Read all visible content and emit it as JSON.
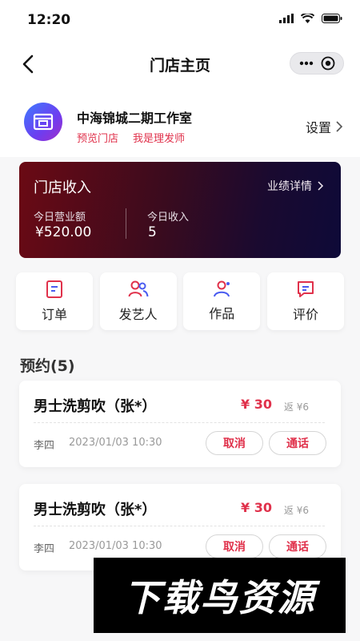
{
  "status_bar": {
    "time": "12:20"
  },
  "nav": {
    "title": "门店主页"
  },
  "store": {
    "name": "中海锦城二期工作室",
    "links": [
      "预览门店",
      "我是理发师"
    ],
    "settings_label": "设置"
  },
  "revenue": {
    "title": "门店收入",
    "detail_label": "业绩详情",
    "stats": [
      {
        "label": "今日营业额",
        "value": "¥520.00"
      },
      {
        "label": "今日收入",
        "value": "5"
      }
    ]
  },
  "quick_menu": [
    {
      "label": "订单",
      "icon": "order-icon"
    },
    {
      "label": "发艺人",
      "icon": "stylist-icon"
    },
    {
      "label": "作品",
      "icon": "works-icon"
    },
    {
      "label": "评价",
      "icon": "review-icon"
    }
  ],
  "bookings": {
    "title": "预约(5)",
    "items": [
      {
        "service": "男士洗剪吹（张*）",
        "price": "¥ 30",
        "rebate": "返 ¥6",
        "customer": "李四",
        "time": "2023/01/03 10:30",
        "cancel_label": "取消",
        "call_label": "通话"
      },
      {
        "service": "男士洗剪吹（张*）",
        "price": "¥ 30",
        "rebate": "返 ¥6",
        "customer": "李四",
        "time": "2023/01/03 10:30",
        "cancel_label": "取消",
        "call_label": "通话"
      }
    ]
  },
  "watermark": "下载鸟资源",
  "colors": {
    "accent": "#e0314b",
    "card_start": "#6b0a14",
    "card_end": "#0e0a38"
  }
}
